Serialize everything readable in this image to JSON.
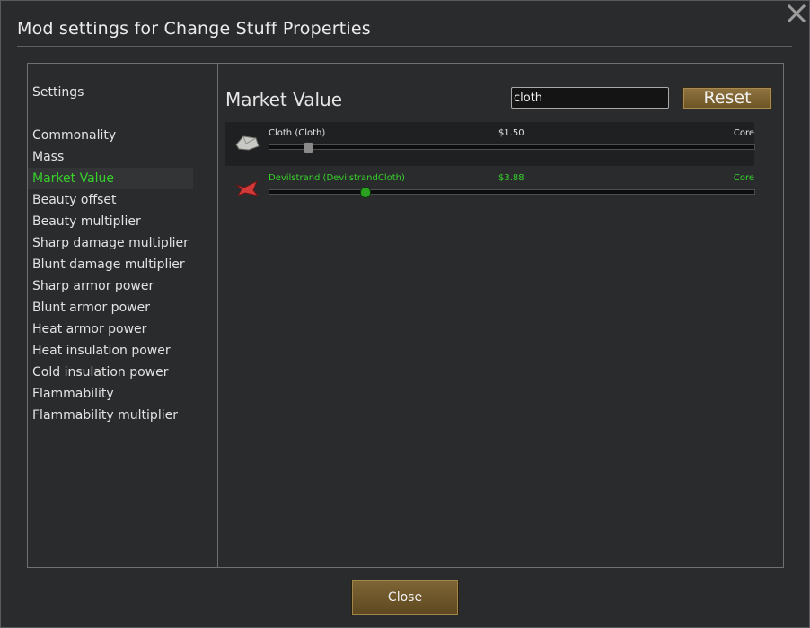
{
  "dialog": {
    "title": "Mod settings for Change Stuff Properties"
  },
  "sidebar": {
    "heading": "Settings",
    "items": [
      {
        "label": "Commonality"
      },
      {
        "label": "Mass"
      },
      {
        "label": "Market Value",
        "active": true
      },
      {
        "label": "Beauty offset"
      },
      {
        "label": "Beauty multiplier"
      },
      {
        "label": "Sharp damage multiplier"
      },
      {
        "label": "Blunt damage multiplier"
      },
      {
        "label": "Sharp armor power"
      },
      {
        "label": "Blunt armor power"
      },
      {
        "label": "Heat armor power"
      },
      {
        "label": "Heat insulation power"
      },
      {
        "label": "Cold insulation power"
      },
      {
        "label": "Flammability"
      },
      {
        "label": "Flammability multiplier"
      }
    ]
  },
  "main": {
    "title": "Market Value",
    "search": {
      "value": "cloth"
    },
    "reset_label": "Reset",
    "rows": [
      {
        "name": "Cloth (Cloth)",
        "value": "$1.50",
        "source": "Core",
        "slider_fraction": 0.08,
        "icon": "cloth-icon",
        "highlighted": false
      },
      {
        "name": "Devilstrand (DevilstrandCloth)",
        "value": "$3.88",
        "source": "Core",
        "slider_fraction": 0.196,
        "icon": "devilstrand-icon",
        "highlighted": true
      }
    ]
  },
  "footer": {
    "close_label": "Close"
  },
  "colors": {
    "highlight_green": "#36d22a",
    "button_brown": "#7e6535",
    "panel_bg": "#2a2b2d"
  }
}
